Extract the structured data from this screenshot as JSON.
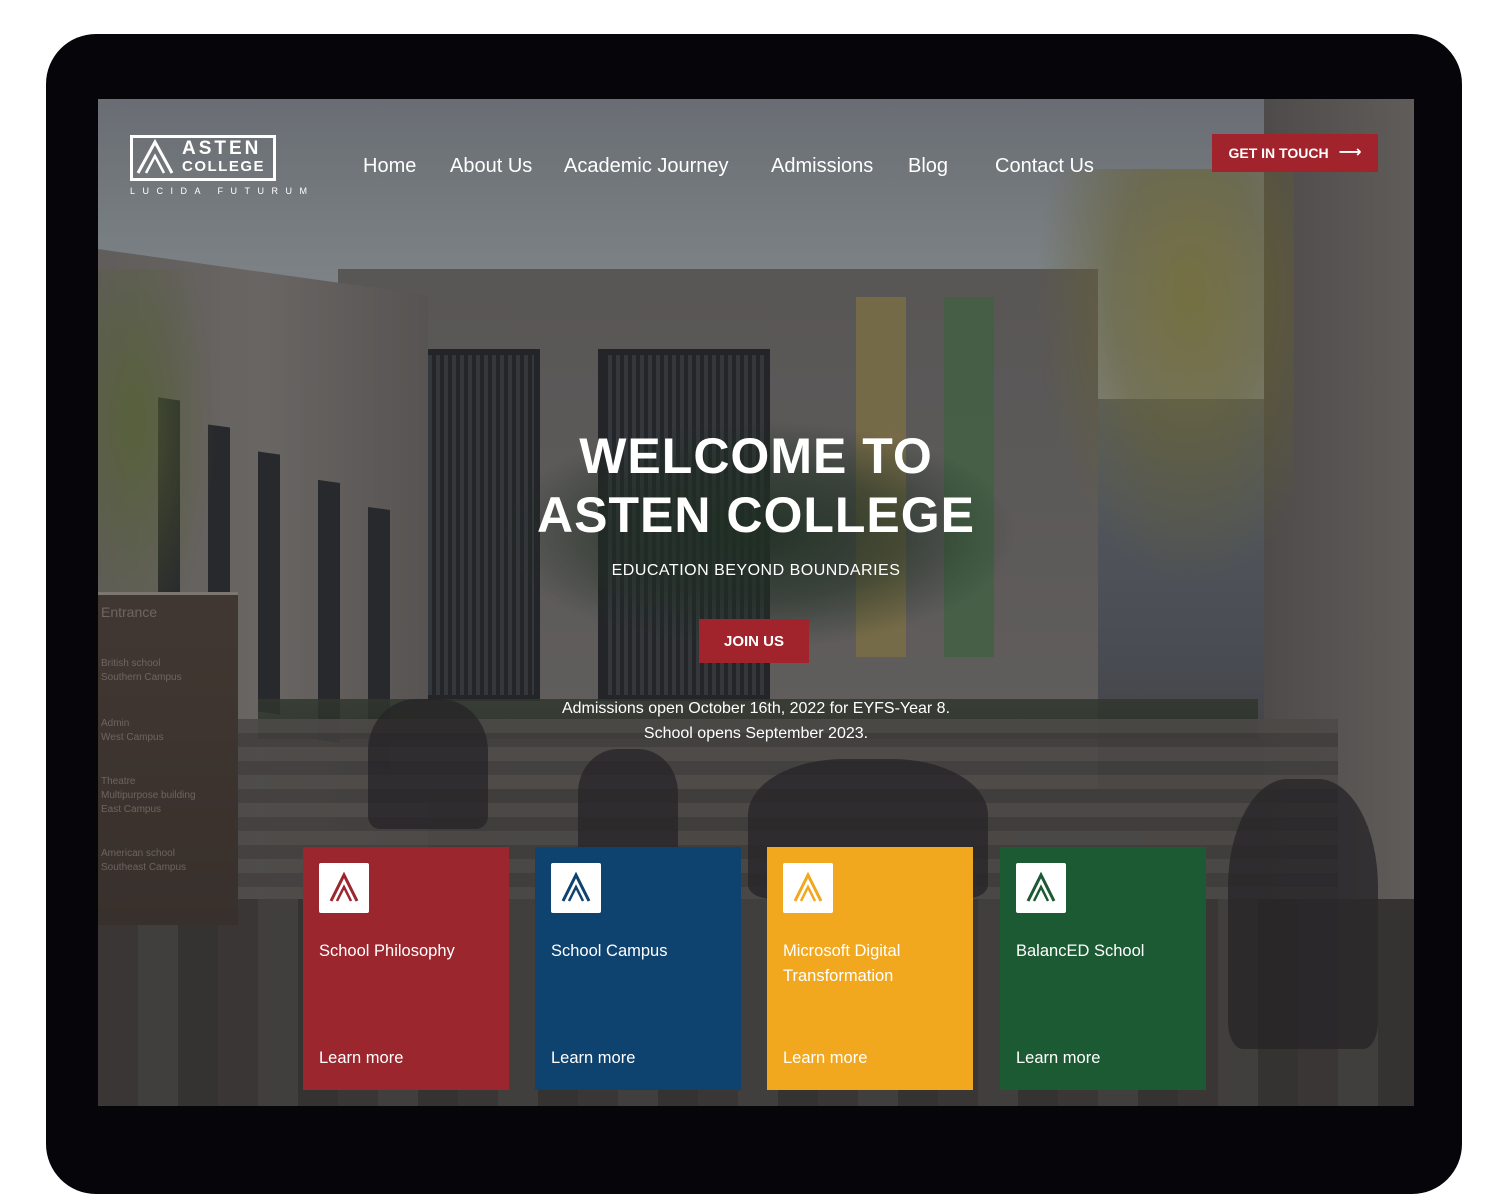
{
  "logo": {
    "word1": "ASTEN",
    "word2": "COLLEGE",
    "tagline": "LUCIDA FUTURUM"
  },
  "nav": {
    "items": [
      {
        "label": "Home"
      },
      {
        "label": "About Us"
      },
      {
        "label": "Academic Journey"
      },
      {
        "label": "Admissions"
      },
      {
        "label": "Blog"
      },
      {
        "label": "Contact Us"
      }
    ]
  },
  "cta": {
    "label": "GET IN TOUCH",
    "icon": "arrow-right-icon"
  },
  "hero": {
    "title_line1": "WELCOME TO",
    "title_line2": "ASTEN COLLEGE",
    "subtitle": "EDUCATION BEYOND BOUNDARIES",
    "button_label": "JOIN US",
    "notice_line1": "Admissions open October 16th, 2022 for EYFS-Year 8.",
    "notice_line2": "School opens September 2023."
  },
  "background_signs": {
    "entrance": "Entrance",
    "lines": [
      "British school",
      "Southern Campus",
      "Admin",
      "West Campus",
      "Theatre",
      "Multipurpose building",
      "East Campus",
      "American school",
      "Southeast Campus"
    ]
  },
  "cards": [
    {
      "title": "School Philosophy",
      "link": "Learn more",
      "color": "#9c262d",
      "icon_color": "#9c262d"
    },
    {
      "title": "School Campus",
      "link": "Learn more",
      "color": "#0e426f",
      "icon_color": "#0e426f"
    },
    {
      "title": "Microsoft Digital Transformation",
      "link": "Learn more",
      "color": "#f2a81e",
      "icon_color": "#f2a81e"
    },
    {
      "title": "BalancED School",
      "link": "Learn more",
      "color": "#1c5a33",
      "icon_color": "#1c5a33"
    }
  ],
  "colors": {
    "accent_red": "#a1242c",
    "device_bezel": "#05050a"
  }
}
